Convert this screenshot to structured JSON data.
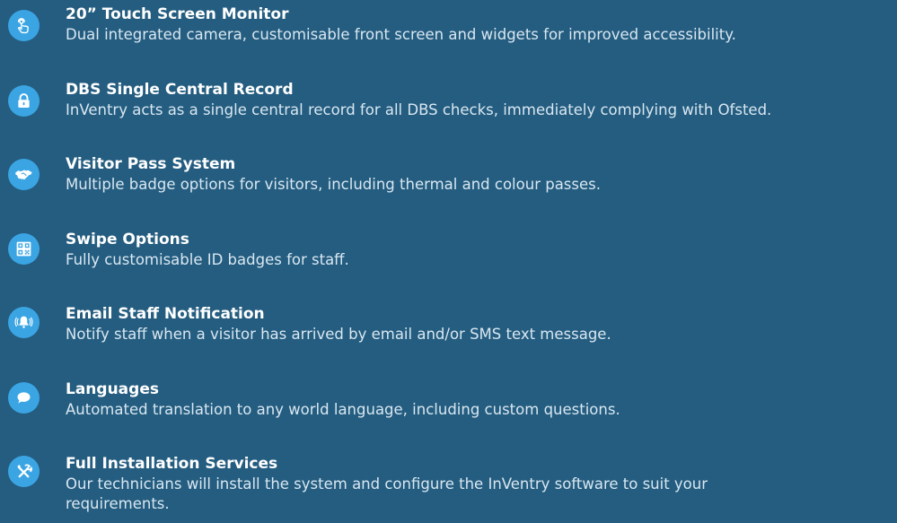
{
  "colors": {
    "background": "#245d80",
    "icon_circle": "#3ba5e4",
    "title_text": "#ffffff",
    "description_text": "#d9e7f1"
  },
  "features": [
    {
      "icon": "touch-icon",
      "title": "20” Touch Screen Monitor",
      "description": "Dual integrated camera, customisable front screen and widgets for improved accessibility."
    },
    {
      "icon": "lock-icon",
      "title": "DBS Single Central Record",
      "description": "InVentry acts as a single central record for all DBS checks, immediately complying with Ofsted."
    },
    {
      "icon": "handshake-icon",
      "title": "Visitor Pass System",
      "description": "Multiple badge options for visitors, including thermal and colour passes."
    },
    {
      "icon": "qr-code-icon",
      "title": "Swipe Options",
      "description": "Fully customisable ID badges for staff."
    },
    {
      "icon": "bell-icon",
      "title": "Email Staff Notification",
      "description": "Notify staff when a visitor has arrived by email and/or SMS text message."
    },
    {
      "icon": "speech-bubble-icon",
      "title": "Languages",
      "description": "Automated translation to any world language, including custom questions."
    },
    {
      "icon": "tools-icon",
      "title": "Full Installation Services",
      "description": "Our technicians will install the system and configure the InVentry software to suit your requirements."
    }
  ]
}
